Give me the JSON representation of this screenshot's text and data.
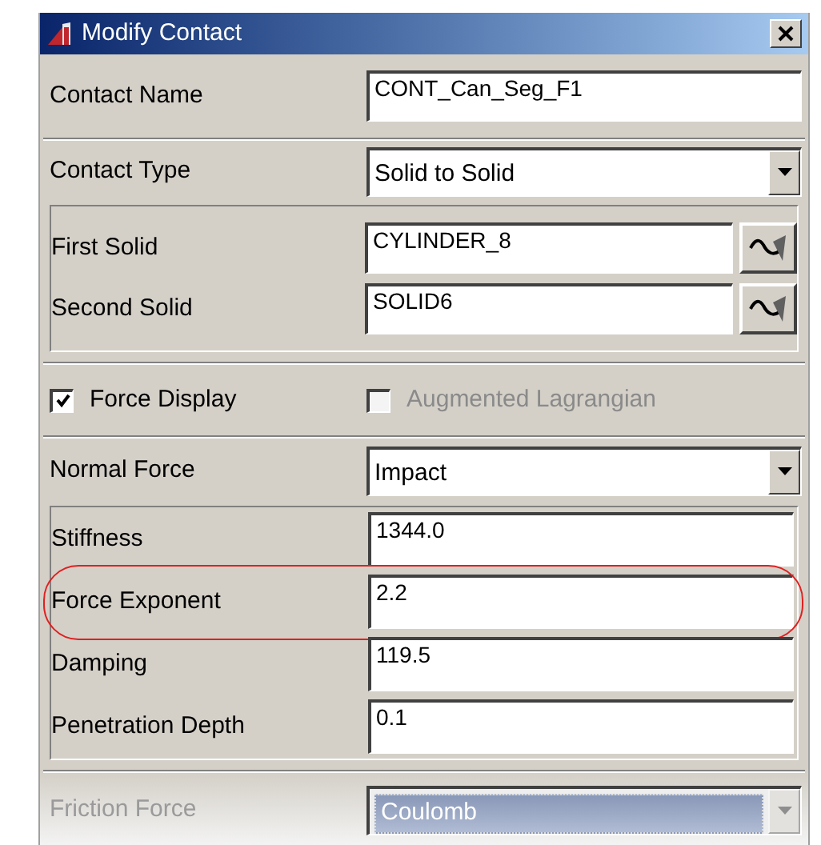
{
  "window": {
    "title": "Modify Contact"
  },
  "contact_name": {
    "label": "Contact Name",
    "value": "CONT_Can_Seg_F1"
  },
  "contact_type": {
    "label": "Contact Type",
    "value": "Solid to Solid"
  },
  "solids": [
    {
      "label": "First Solid",
      "value": "CYLINDER_8"
    },
    {
      "label": "Second Solid",
      "value": "SOLID6"
    }
  ],
  "checkboxes": [
    {
      "label": "Force Display",
      "checked": true,
      "disabled": false
    },
    {
      "label": "Augmented Lagrangian",
      "checked": false,
      "disabled": true
    }
  ],
  "normal_force": {
    "label": "Normal Force",
    "value": "Impact"
  },
  "parameters": [
    {
      "label": "Stiffness",
      "value": "1344.0",
      "highlighted": false
    },
    {
      "label": "Force Exponent",
      "value": "2.2",
      "highlighted": true
    },
    {
      "label": "Damping",
      "value": "119.5",
      "highlighted": false
    },
    {
      "label": "Penetration Depth",
      "value": "0.1",
      "highlighted": false
    }
  ],
  "friction_force": {
    "label": "Friction Force",
    "value": "Coulomb",
    "disabled": true
  }
}
